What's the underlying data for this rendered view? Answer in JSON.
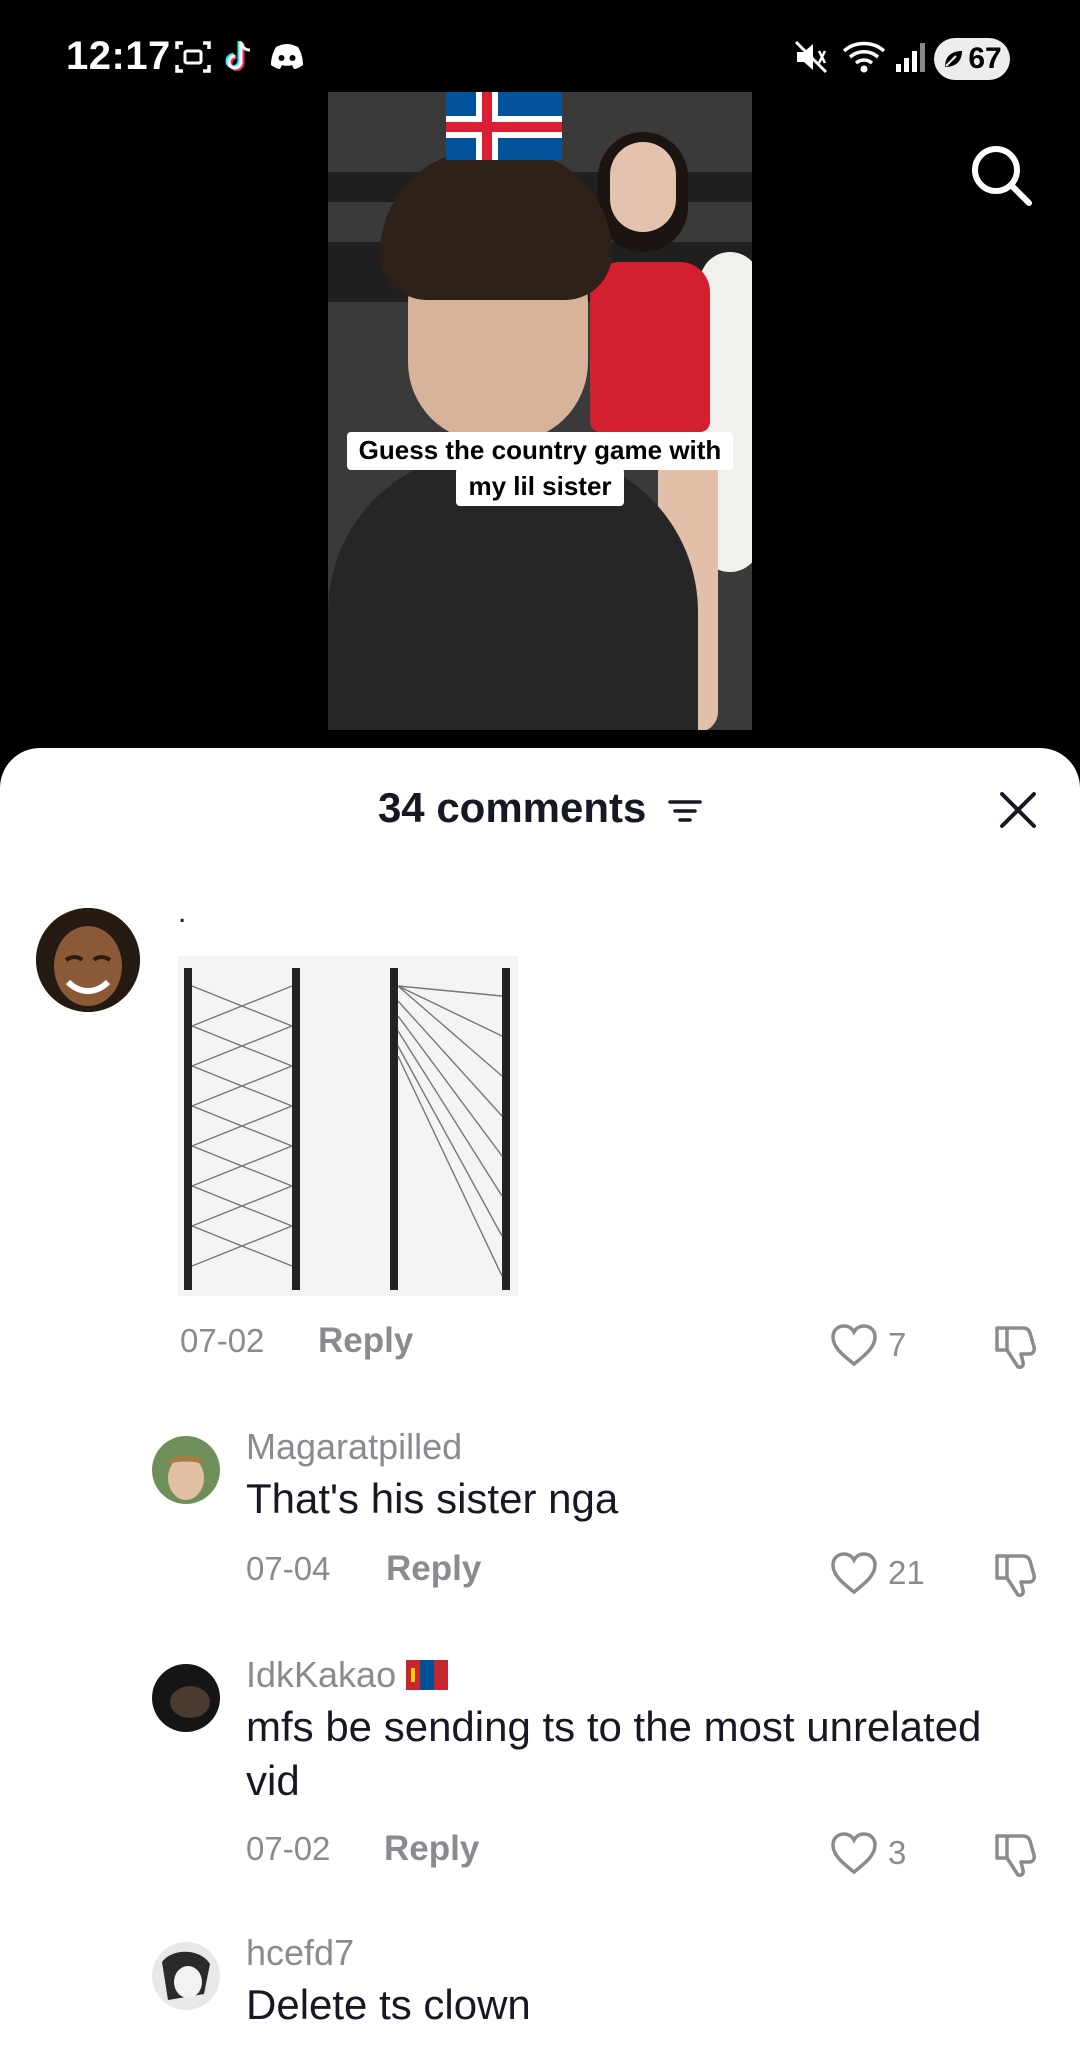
{
  "status_bar": {
    "time": "12:17",
    "battery": "67"
  },
  "video": {
    "caption_line1": "Guess the country game with",
    "caption_line2": "my lil sister"
  },
  "comments_header": {
    "title": "34 comments"
  },
  "comments": [
    {
      "username": "",
      "text": ".",
      "date": "07-02",
      "reply_label": "Reply",
      "likes": "7"
    },
    {
      "username": "Magaratpilled",
      "text": "That's his sister nga",
      "date": "07-04",
      "reply_label": "Reply",
      "likes": "21"
    },
    {
      "username": "IdkKakao",
      "text": "mfs be sending ts to the most unrelated vid",
      "date": "07-02",
      "reply_label": "Reply",
      "likes": "3"
    },
    {
      "username": "hcefd7",
      "text": "Delete ts clown"
    }
  ]
}
